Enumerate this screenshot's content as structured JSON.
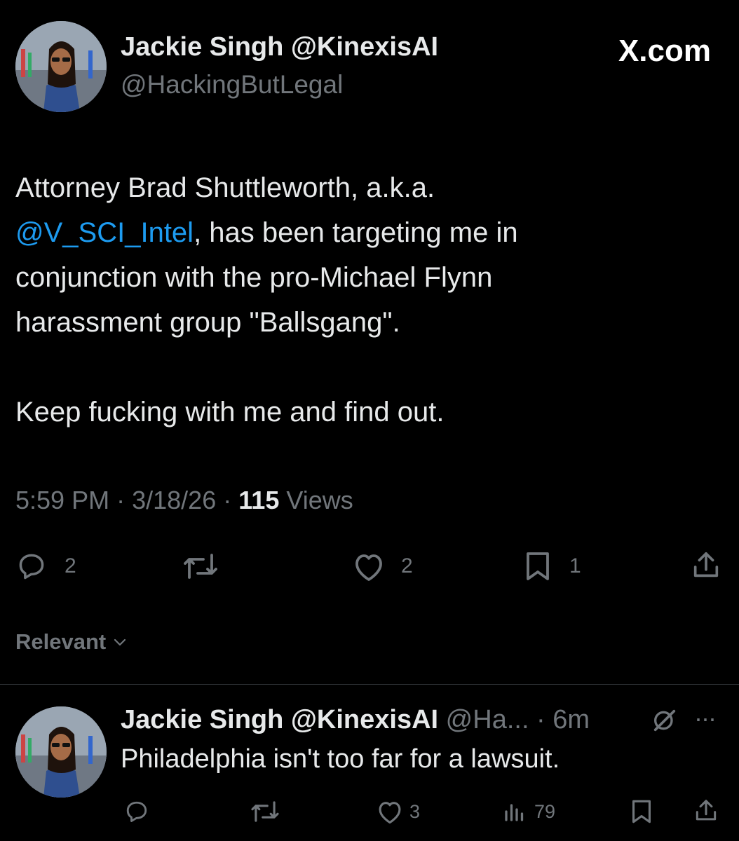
{
  "post": {
    "author_name": "Jackie Singh @KinexisAI",
    "author_handle": "@HackingButLegal",
    "site_label": "X.com",
    "body_line1": "Attorney Brad Shuttleworth, a.k.a.",
    "mention": "@V_SCI_Intel",
    "body_line2_rest": ", has been targeting me in",
    "body_line3": "conjunction with the pro-Michael Flynn",
    "body_line4": "harassment group \"Ballsgang\".",
    "body_line5": "Keep fucking with me and find out.",
    "time": "5:59 PM",
    "sep1": "·",
    "date": "3/18/26",
    "sep2": "·",
    "views_count": "115",
    "views_label": "Views",
    "actions": {
      "replies": "2",
      "likes": "2",
      "bookmarks": "1"
    }
  },
  "sort": {
    "label": "Relevant"
  },
  "reply": {
    "author_name": "Jackie Singh @KinexisAI",
    "handle_time": "@Ha... · 6m",
    "text": "Philadelphia isn't too far for a lawsuit.",
    "more": "···",
    "actions": {
      "likes": "3",
      "views": "79"
    }
  },
  "icons": {
    "reply": "reply-icon",
    "repost": "repost-icon",
    "like": "like-icon",
    "bookmark": "bookmark-icon",
    "share": "share-icon",
    "views": "views-icon",
    "chevron": "chevron-down-icon",
    "grok": "grok-icon",
    "more": "more-icon"
  },
  "colors": {
    "background": "#000000",
    "text": "#e7e9ea",
    "muted": "#71767b",
    "link": "#1d9bf0"
  }
}
